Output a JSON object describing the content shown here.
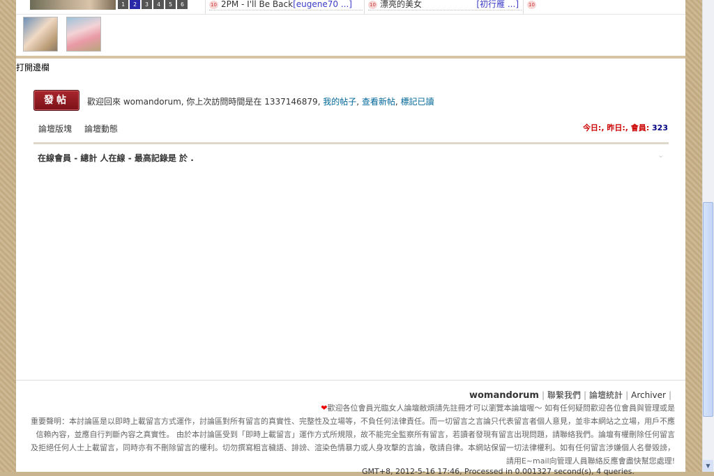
{
  "top": {
    "pager": [
      "1",
      "2",
      "3",
      "4",
      "5",
      "6"
    ],
    "pager_active": "2",
    "hot_posts": [
      {
        "badge": "10",
        "title": "2PM - I'll Be Back",
        "author": "[eugene70 ...]"
      },
      {
        "badge": "10",
        "title": "漂亮的美女",
        "author": "[初行雁 ...]"
      },
      {
        "badge": "10",
        "title": "",
        "author": ""
      }
    ]
  },
  "sidebar_toggle": "打開邊欄",
  "post_button": "發帖",
  "welcome": {
    "text": "歡迎回來 womandorum, 你上次訪問時間是在 1337146879, ",
    "my_posts": "我的帖子",
    "sep1": ", ",
    "new_posts": "查看新帖",
    "sep2": ", ",
    "mark_read": "標記已讀"
  },
  "tabs": [
    "論壇版塊",
    "論壇動態"
  ],
  "stats": {
    "today_label": "今日:",
    "yesterday_label": ", 昨日:",
    "members_label": ", 會員:",
    "members": "323"
  },
  "online": {
    "label": "在線會員",
    "text": " - 總計 人在線 - 最高記錄是 於 ."
  },
  "footer": {
    "site": "womandorum",
    "links": [
      "聯繫我們",
      "論壇統計",
      "Archiver"
    ],
    "notice_welcome": "歡迎各位會員光臨女人論壇敝煩請先註冊才可以瀏覽本論壇喔～ 如有任何疑問歡迎各位會員與管理或是",
    "notice_disclaimer": "重要聲明：本討論區是以即時上載留言方式運作，討論區對所有留言的真實性、完整性及立場等，不負任何法律責任。而一切留言之言論只代表留言者個人意見，並非本網站之立場，用戶不應信賴內容，並應自行判斷內容之真實性。 由於本討論區受到「即時上載留言」運作方式所規限，故不能完全監察所有留言，若讀者發現有留言出現問題，請聯絡我們。論壇有權刪除任何留言及拒絕任何人士上載留言，同時亦有不刪除留言的權利。切勿撰寫粗言穢語、誹謗、渲染色情暴力或人身攻擊的言論，敬請自律。本網站保留一切法律權利。如有任何留言涉嫌個人名譽毀謗，請用E~mail向管理人員聯絡反應會盡快幫您處理!",
    "gmt_line": "GMT+8, 2012-5-16 17:46, Processed in 0.001327 second(s), 4 queries."
  },
  "colors": {
    "page_bg": "#c8b48e",
    "link": "#006699",
    "post_button": "#8a1a20",
    "stats_label": "#cc0000",
    "stats_number": "#000080"
  }
}
